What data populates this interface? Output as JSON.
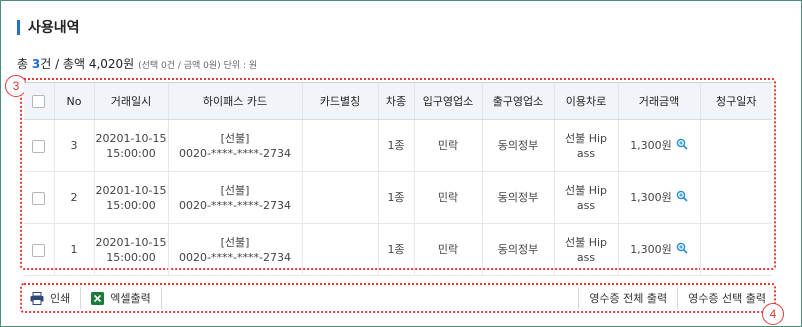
{
  "header": {
    "title": "사용내역"
  },
  "summary": {
    "total_prefix": "총 ",
    "total_count": "3",
    "total_count_unit": "건 / 총액 ",
    "total_amount": "4,020원",
    "selection_info": "(선택 0건 / 금액 0원)",
    "unit_label": " 단위 : 원"
  },
  "markers": {
    "table": "3",
    "toolbar": "4"
  },
  "table": {
    "columns": [
      "No",
      "거래일시",
      "하이패스 카드",
      "카드별칭",
      "차종",
      "입구영업소",
      "출구영업소",
      "이용차로",
      "거래금액",
      "청구일자"
    ],
    "rows": [
      {
        "no": "3",
        "date": "20201-10-15",
        "time": "15:00:00",
        "card_type": "[선불]",
        "card_no": "0020-****-****-2734",
        "alias": "",
        "car_class": "1종",
        "entry": "민락",
        "exit": "동의정부",
        "lane_1": "선불 Hip",
        "lane_2": "ass",
        "amount": "1,300원",
        "bill_date": ""
      },
      {
        "no": "2",
        "date": "20201-10-15",
        "time": "15:00:00",
        "card_type": "[선불]",
        "card_no": "0020-****-****-2734",
        "alias": "",
        "car_class": "1종",
        "entry": "민락",
        "exit": "동의정부",
        "lane_1": "선불 Hip",
        "lane_2": "ass",
        "amount": "1,300원",
        "bill_date": ""
      },
      {
        "no": "1",
        "date": "20201-10-15",
        "time": "15:00:00",
        "card_type": "[선불]",
        "card_no": "0020-****-****-2734",
        "alias": "",
        "car_class": "1종",
        "entry": "민락",
        "exit": "동의정부",
        "lane_1": "선불 Hip",
        "lane_2": "ass",
        "amount": "1,300원",
        "bill_date": ""
      }
    ]
  },
  "toolbar": {
    "print_label": "인쇄",
    "excel_label": "엑셀출력",
    "receipt_all_label": "영수증 전체 출력",
    "receipt_selected_label": "영수증 선택 출력"
  },
  "icons": {
    "print": "printer-icon",
    "excel": "excel-icon",
    "zoom": "zoom-in-icon"
  },
  "colors": {
    "accent": "#1f6fd0",
    "marker": "#e53935",
    "frame": "#4a8f7a",
    "excel": "#1e7a3c"
  }
}
